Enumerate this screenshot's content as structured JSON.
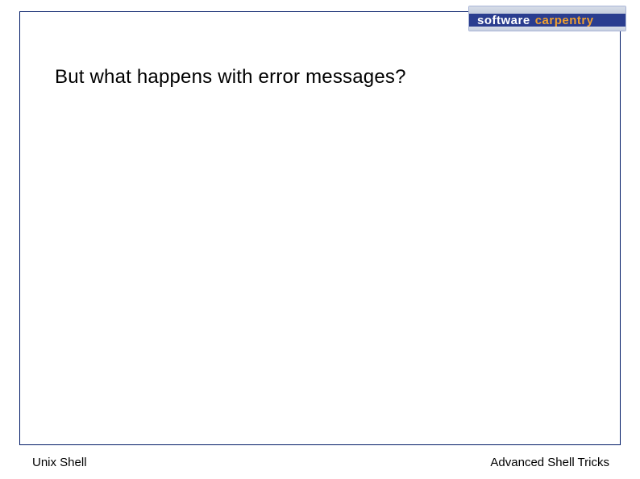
{
  "logo": {
    "word1": "software",
    "word2": "carpentry"
  },
  "content": {
    "heading": "But what happens with error messages?"
  },
  "footer": {
    "left": "Unix Shell",
    "right": "Advanced Shell Tricks"
  }
}
